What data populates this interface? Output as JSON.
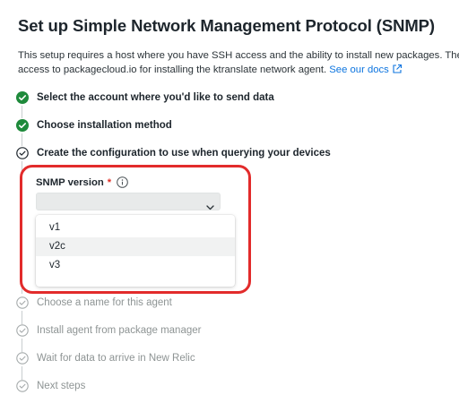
{
  "header": {
    "title": "Set up Simple Network Management Protocol (SNMP)",
    "description_line1": "This setup requires a host where you have SSH access and the ability to install new packages. The h",
    "description_line2": "access to packagecloud.io for installing the ktranslate network agent. ",
    "docs_link": "See our docs"
  },
  "steps": [
    {
      "label": "Select the account where you'd like to send data",
      "status": "done",
      "icon": "check-circle-icon"
    },
    {
      "label": "Choose installation method",
      "status": "done",
      "icon": "check-circle-icon"
    },
    {
      "label": "Create the configuration to use when querying your devices",
      "status": "current",
      "icon": "check-outline-icon"
    },
    {
      "label": "Choose a name for this agent",
      "status": "pending",
      "icon": "check-outline-icon"
    },
    {
      "label": "Install agent from package manager",
      "status": "pending",
      "icon": "check-outline-icon"
    },
    {
      "label": "Wait for data to arrive in New Relic",
      "status": "pending",
      "icon": "check-outline-icon"
    },
    {
      "label": "Next steps",
      "status": "pending",
      "icon": "check-outline-icon"
    }
  ],
  "form": {
    "snmp_version_label": "SNMP version",
    "required_marker": "*",
    "selected_value": "",
    "options": [
      "v1",
      "v2c",
      "v3"
    ],
    "hovered_option": "v2c"
  },
  "colors": {
    "success": "#1e8a3b",
    "link": "#0c74df",
    "highlight_border": "#e22b2b",
    "required": "#df2d24"
  }
}
